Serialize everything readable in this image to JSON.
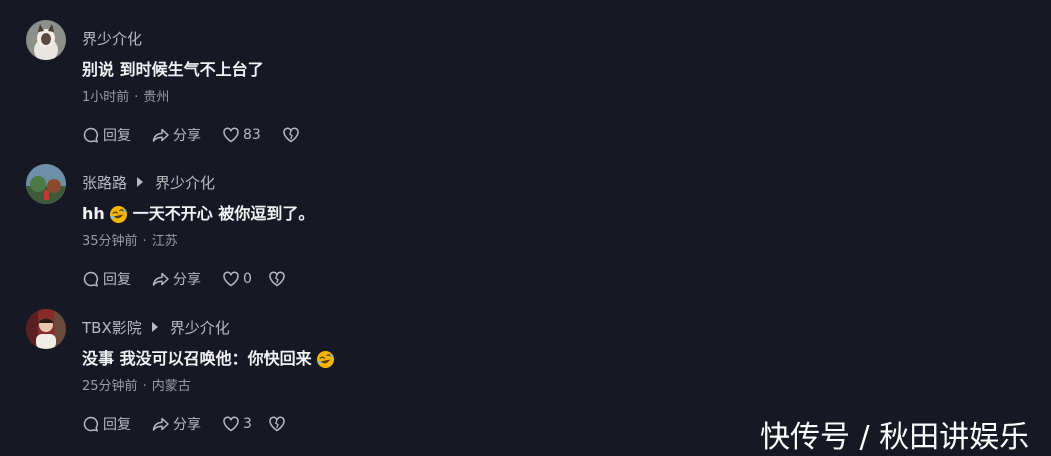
{
  "comments": [
    {
      "author": "界少介化",
      "reply_to": "",
      "text_before": "别说 到时候生气不上台了",
      "emoji": "",
      "text_after": "",
      "time": "1小时前",
      "location": "贵州",
      "actions": {
        "reply": "回复",
        "share": "分享",
        "likes": "83"
      },
      "avatar_icon": "cat-avatar-icon"
    },
    {
      "author": "张路路",
      "reply_to": "界少介化",
      "text_before": "hh",
      "emoji": "rolling-on-floor-laughing-emoji",
      "text_after": "一天不开心 被你逗到了。",
      "time": "35分钟前",
      "location": "江苏",
      "actions": {
        "reply": "回复",
        "share": "分享",
        "likes": "0"
      },
      "avatar_icon": "landscape-avatar-icon"
    },
    {
      "author": "TBX影院",
      "reply_to": "界少介化",
      "text_before": "没事 我没可以召唤他：你快回来",
      "emoji": "rolling-on-floor-laughing-emoji",
      "text_after": "",
      "time": "25分钟前",
      "location": "内蒙古",
      "actions": {
        "reply": "回复",
        "share": "分享",
        "likes": "3"
      },
      "avatar_icon": "person-avatar-icon"
    }
  ],
  "meta_separator": "·",
  "watermark": "快传号 / 秋田讲娱乐",
  "colors": {
    "background": "#161823",
    "name": "#b9bac0",
    "text": "#f2f2f4",
    "meta": "#9a9ba3",
    "emoji": "#f7b500"
  }
}
